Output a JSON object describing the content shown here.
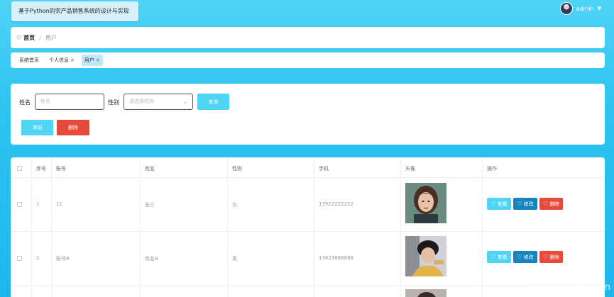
{
  "app": {
    "title": "基于Python的农产品销售系统的设计与实现"
  },
  "user": {
    "name": "admin"
  },
  "breadcrumb": {
    "home": "首页",
    "current": "用户"
  },
  "tags": [
    {
      "label": "系统首页"
    },
    {
      "label": "个人信息"
    },
    {
      "label": "用户"
    }
  ],
  "search": {
    "name_label": "姓名",
    "name_placeholder": "姓名",
    "gender_label": "性别",
    "gender_placeholder": "请选择性别",
    "query_label": "查询",
    "add_label": "添加",
    "delete_label": "删除"
  },
  "table": {
    "columns": [
      "序号",
      "账号",
      "姓名",
      "性别",
      "手机",
      "头像",
      "操作"
    ],
    "rows": [
      {
        "index": "1",
        "account": "11",
        "name": "张三",
        "gender": "女",
        "phone": "13922222222"
      },
      {
        "index": "2",
        "account": "账号8",
        "name": "姓名8",
        "gender": "男",
        "phone": "13823888888"
      }
    ],
    "actions": {
      "view": "查看",
      "edit": "修改",
      "delete": "删除"
    }
  },
  "watermark": "CSDN @firepation",
  "colors": {
    "accent": "#50d4f6",
    "danger": "#e64a3b",
    "edit": "#1784bf"
  }
}
